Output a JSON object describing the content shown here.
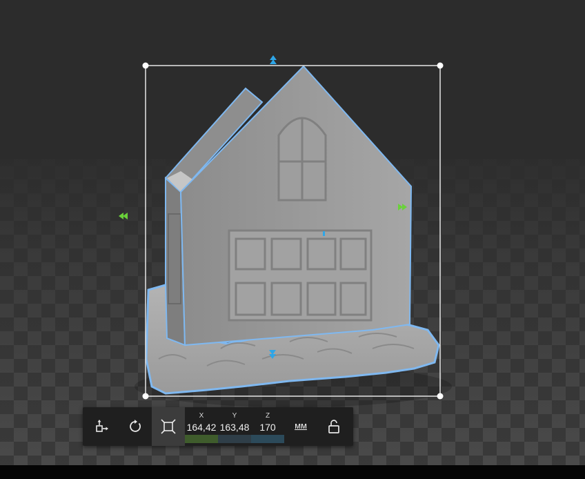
{
  "scale_tool": {
    "x": {
      "label": "X",
      "value": "164,42"
    },
    "y": {
      "label": "Y",
      "value": "163,48"
    },
    "z": {
      "label": "Z",
      "value": "170"
    },
    "unit": "мм"
  },
  "icons": {
    "move": "move-tool-icon",
    "rotate": "rotate-tool-icon",
    "scale": "scale-tool-icon",
    "lock": "unlocked-padlock-icon"
  },
  "colors": {
    "background": "#2c2c2c",
    "selection_outline": "#7fb8f0",
    "handle_blue": "#2ea6e8",
    "handle_green": "#6ad13a",
    "toolbar": "#1f1f1f",
    "toolbar_active": "#3c3c3c",
    "x_bar": "#3f5c2c",
    "y_bar": "#2f3e48",
    "z_bar": "#2c4a5a"
  }
}
